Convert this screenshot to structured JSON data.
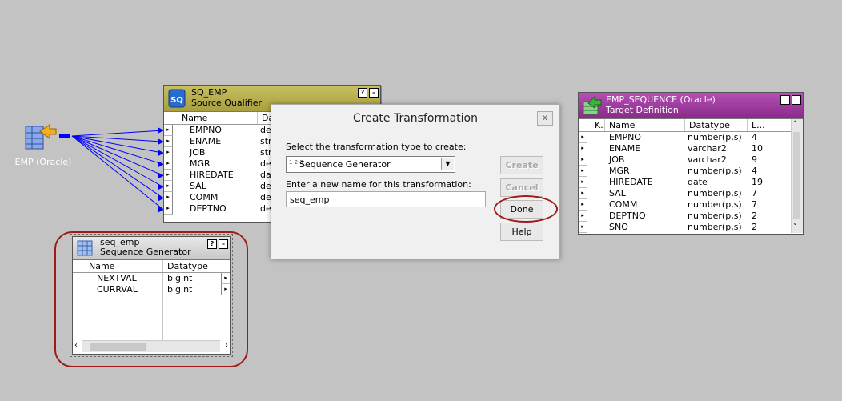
{
  "source_icon": {
    "label": "EMP (Oracle)"
  },
  "sq_emp": {
    "title": "SQ_EMP",
    "subtitle": "Source Qualifier",
    "help_icon": "?",
    "columns": [
      "Name",
      "Datatype"
    ],
    "rows": [
      {
        "name": "EMPNO",
        "type": "de"
      },
      {
        "name": "ENAME",
        "type": "stri"
      },
      {
        "name": "JOB",
        "type": "stri"
      },
      {
        "name": "MGR",
        "type": "de"
      },
      {
        "name": "HIREDATE",
        "type": "dat"
      },
      {
        "name": "SAL",
        "type": "de"
      },
      {
        "name": "COMM",
        "type": "de"
      },
      {
        "name": "DEPTNO",
        "type": "de"
      }
    ]
  },
  "seq_gen": {
    "title": "seq_emp",
    "subtitle": "Sequence Generator",
    "help_icon": "?",
    "columns": [
      "Name",
      "Datatype"
    ],
    "rows": [
      {
        "name": "NEXTVAL",
        "type": "bigint"
      },
      {
        "name": "CURRVAL",
        "type": "bigint"
      }
    ]
  },
  "target": {
    "title": "EMP_SEQUENCE (Oracle)",
    "subtitle": "Target Definition",
    "help_icon": "?",
    "columns": [
      "K..",
      "Name",
      "Datatype",
      "L..."
    ],
    "rows": [
      {
        "name": "EMPNO",
        "type": "number(p,s)",
        "len": "4"
      },
      {
        "name": "ENAME",
        "type": "varchar2",
        "len": "10"
      },
      {
        "name": "JOB",
        "type": "varchar2",
        "len": "9"
      },
      {
        "name": "MGR",
        "type": "number(p,s)",
        "len": "4"
      },
      {
        "name": "HIREDATE",
        "type": "date",
        "len": "19"
      },
      {
        "name": "SAL",
        "type": "number(p,s)",
        "len": "7"
      },
      {
        "name": "COMM",
        "type": "number(p,s)",
        "len": "7"
      },
      {
        "name": "DEPTNO",
        "type": "number(p,s)",
        "len": "2"
      },
      {
        "name": "SNO",
        "type": "number(p,s)",
        "len": "2"
      }
    ]
  },
  "dialog": {
    "title": "Create Transformation",
    "close": "x",
    "type_label": "Select the transformation type to create:",
    "type_prefix": "1 2 3",
    "type_value": "Sequence Generator",
    "name_label": "Enter a new name for this transformation:",
    "name_value": "seq_emp",
    "buttons": {
      "create": "Create",
      "cancel": "Cancel",
      "done": "Done",
      "help": "Help"
    }
  },
  "colors": {
    "canvas": "#c3c3c3",
    "source_qualifier": "#b0a848",
    "target": "#9b3a9b",
    "highlight": "#a01a1a",
    "links": "#0000ff"
  }
}
